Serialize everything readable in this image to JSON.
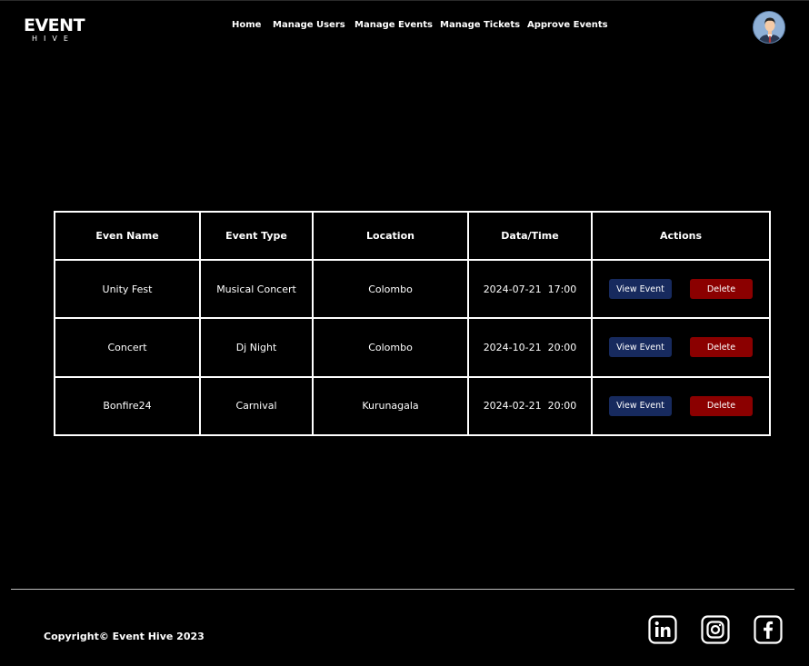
{
  "logo": {
    "main": "EVENT",
    "sub": "HIVE"
  },
  "nav": {
    "home": "Home",
    "manage_users": "Manage Users",
    "manage_events": "Manage Events",
    "manage_tickets": "Manage Tickets",
    "approve_events": "Approve Events"
  },
  "table": {
    "headers": [
      "Even Name",
      "Event Type",
      "Location",
      "Data/Time",
      "Actions"
    ],
    "rows": [
      {
        "name": "Unity Fest",
        "type": "Musical Concert",
        "location": "Colombo",
        "datetime": "2024-07-21  17:00"
      },
      {
        "name": "Concert",
        "type": "Dj Night",
        "location": "Colombo",
        "datetime": "2024-10-21  20:00"
      },
      {
        "name": "Bonfire24",
        "type": "Carnival",
        "location": "Kurunagala",
        "datetime": "2024-02-21  20:00"
      }
    ],
    "view_label": "View Event",
    "delete_label": "Delete"
  },
  "footer": {
    "copyright": "Copyright© Event Hive 2023",
    "social_icons": [
      "linkedin-icon",
      "instagram-icon",
      "facebook-icon"
    ]
  },
  "colors": {
    "background": "#000000",
    "view_button": "#172a5e",
    "delete_button": "#8b0000"
  }
}
